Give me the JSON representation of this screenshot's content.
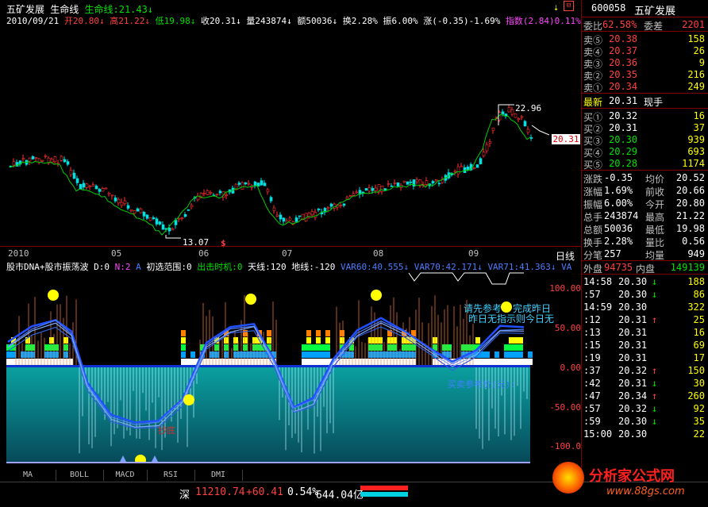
{
  "header": {
    "stock_name": "五矿发展",
    "indicator_name": "生命线",
    "indicator_value": "生命线:21.43↓",
    "date": "2010/09/21",
    "open": "开20.80↓",
    "high": "高21.22↓",
    "low": "低19.98↓",
    "close": "收20.31↓",
    "volume": "量243874↓",
    "amount": "额50036↓",
    "turnover": "换2.28%",
    "amplitude": "振6.00%",
    "change": "涨(-0.35)-1.69%",
    "index": "指数(2.84)0.11%"
  },
  "price_chart": {
    "high_label": "22.96",
    "low_label": "13.07",
    "current_label": "20.31",
    "dollar_marker": "$",
    "date_labels": [
      "2010",
      "05",
      "06",
      "07",
      "08",
      "09"
    ],
    "period_label": "日线"
  },
  "indicator": {
    "title": "股市DNA+股市振荡波",
    "d": "D:0",
    "n": "N:2",
    "a": "A",
    "range": "初选范围:0",
    "timing": "出击时机:0",
    "tianxian": "天线:120",
    "dixian": "地线:-120",
    "var60": "VAR60:40.555↓",
    "var70": "VAR70:42.171↓",
    "var71": "VAR71:41.363↓",
    "var_tail": "VA",
    "note1": "请先参考",
    "note1b": "完成昨日",
    "note2": "昨日无指示则今日无",
    "note3": "买卖参考价(元):",
    "bottom_label": "抄底",
    "yticks": [
      "100.00",
      "50.00",
      "0.00",
      "-50.00",
      "-100.0"
    ]
  },
  "tabs": [
    "MA",
    "BOLL",
    "MACD",
    "RSI",
    "DMI"
  ],
  "right_panel": {
    "code": "600058",
    "name": "五矿发展",
    "ratio_label": "委比",
    "ratio": "62.58%",
    "diff_label": "委差",
    "diff": "2201",
    "asks": [
      {
        "label": "卖⑤",
        "price": "20.38",
        "vol": "158"
      },
      {
        "label": "卖④",
        "price": "20.37",
        "vol": "26"
      },
      {
        "label": "卖③",
        "price": "20.36",
        "vol": "9"
      },
      {
        "label": "卖②",
        "price": "20.35",
        "vol": "216"
      },
      {
        "label": "卖①",
        "price": "20.34",
        "vol": "249"
      }
    ],
    "last_label": "最新",
    "last": "20.31",
    "hand_label": "现手",
    "bids": [
      {
        "label": "买①",
        "price": "20.32",
        "vol": "16"
      },
      {
        "label": "买②",
        "price": "20.31",
        "vol": "37"
      },
      {
        "label": "买③",
        "price": "20.30",
        "vol": "939"
      },
      {
        "label": "买④",
        "price": "20.29",
        "vol": "693"
      },
      {
        "label": "买⑤",
        "price": "20.28",
        "vol": "1174"
      }
    ],
    "stats": [
      {
        "l1": "涨跌",
        "v1": "-0.35",
        "l2": "均价",
        "v2": "20.52"
      },
      {
        "l1": "涨幅",
        "v1": "1.69%",
        "l2": "前收",
        "v2": "20.66"
      },
      {
        "l1": "振幅",
        "v1": "6.00%",
        "l2": "今开",
        "v2": "20.80"
      },
      {
        "l1": "总手",
        "v1": "243874",
        "l2": "最高",
        "v2": "21.22"
      },
      {
        "l1": "总额",
        "v1": "50036",
        "l2": "最低",
        "v2": "19.98"
      },
      {
        "l1": "换手",
        "v1": "2.28%",
        "l2": "量比",
        "v2": "0.56"
      },
      {
        "l1": "分笔",
        "v1": "257",
        "l2": "均量",
        "v2": "949"
      }
    ],
    "outer_label": "外盘",
    "outer": "94735",
    "inner_label": "内盘",
    "inner": "149139",
    "ticks": [
      {
        "t": "14:58",
        "p": "20.30",
        "v": "188",
        "a": "↓"
      },
      {
        "t": ":57",
        "p": "20.30",
        "v": "86",
        "a": "↓"
      },
      {
        "t": "14:59",
        "p": "20.30",
        "v": "322",
        "a": ""
      },
      {
        "t": ":12",
        "p": "20.31",
        "v": "25",
        "a": "↑"
      },
      {
        "t": ":13",
        "p": "20.31",
        "v": "16",
        "a": ""
      },
      {
        "t": ":15",
        "p": "20.31",
        "v": "69",
        "a": ""
      },
      {
        "t": ":19",
        "p": "20.31",
        "v": "17",
        "a": ""
      },
      {
        "t": ":37",
        "p": "20.32",
        "v": "150",
        "a": "↑"
      },
      {
        "t": ":42",
        "p": "20.31",
        "v": "30",
        "a": "↓"
      },
      {
        "t": ":47",
        "p": "20.34",
        "v": "260",
        "a": "↑"
      },
      {
        "t": ":57",
        "p": "20.32",
        "v": "92",
        "a": "↓"
      },
      {
        "t": ":59",
        "p": "20.30",
        "v": "35",
        "a": "↓"
      },
      {
        "t": "15:00",
        "p": "20.30",
        "v": "22",
        "a": ""
      }
    ]
  },
  "status_bar": {
    "market": "深",
    "index": "11210.74",
    "change": "+60.41",
    "pct": "0.54%",
    "amount": "644.04亿"
  },
  "logo": {
    "text": "分析家公式网",
    "url": "www.88gs.com"
  }
}
